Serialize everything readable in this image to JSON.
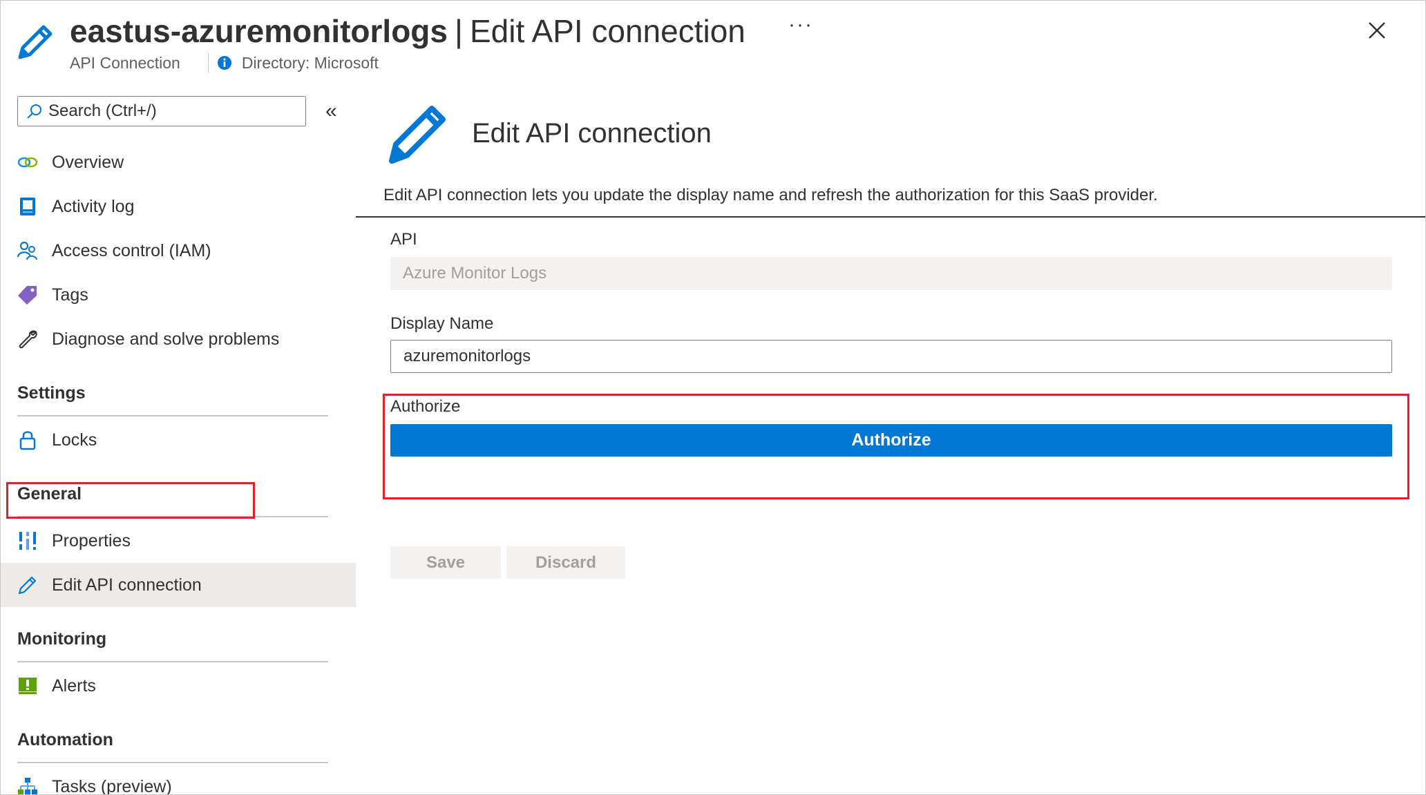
{
  "header": {
    "resource_name": "eastus-azuremonitorlogs",
    "separator": "|",
    "blade_title": "Edit API connection",
    "more_label": "···",
    "resource_type": "API Connection",
    "directory": "Directory: Microsoft",
    "icon": "pencil-icon"
  },
  "sidebar": {
    "search_placeholder": "Search (Ctrl+/)",
    "collapse_label": "«",
    "items": [
      {
        "label": "Overview",
        "icon": "overview-icon"
      },
      {
        "label": "Activity log",
        "icon": "activity-log-icon"
      },
      {
        "label": "Access control (IAM)",
        "icon": "iam-icon"
      },
      {
        "label": "Tags",
        "icon": "tag-icon"
      },
      {
        "label": "Diagnose and solve problems",
        "icon": "wrench-icon"
      }
    ],
    "sections": [
      {
        "title": "Settings",
        "items": [
          {
            "label": "Locks",
            "icon": "lock-icon"
          }
        ]
      },
      {
        "title": "General",
        "items": [
          {
            "label": "Properties",
            "icon": "properties-icon"
          },
          {
            "label": "Edit API connection",
            "icon": "pencil-icon",
            "selected": true
          }
        ]
      },
      {
        "title": "Monitoring",
        "items": [
          {
            "label": "Alerts",
            "icon": "alert-icon"
          }
        ]
      },
      {
        "title": "Automation",
        "items": [
          {
            "label": "Tasks (preview)",
            "icon": "tasks-icon"
          }
        ]
      }
    ]
  },
  "main": {
    "heading": "Edit API connection",
    "description": "Edit API connection lets you update the display name and refresh the authorization for this SaaS provider.",
    "api_label": "API",
    "api_value": "Azure Monitor Logs",
    "display_name_label": "Display Name",
    "display_name_value": "azuremonitorlogs",
    "authorize_label": "Authorize",
    "authorize_button": "Authorize",
    "save_button": "Save",
    "discard_button": "Discard"
  },
  "colors": {
    "accent": "#0078d4",
    "highlight": "#e3202b",
    "selected_bg": "#edebe9",
    "disabled_bg": "#f3f2f1"
  }
}
